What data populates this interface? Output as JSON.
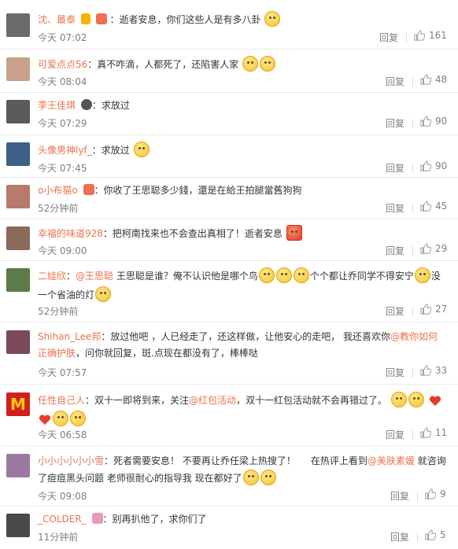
{
  "comments": [
    {
      "name": "沈、最泰",
      "badges": [
        "vip",
        "heart"
      ],
      "text": "：逝者安息，你们这些人是有多八卦",
      "emojis": 1,
      "time": "今天 07:02",
      "reply": "回复",
      "likes": "161",
      "avatar_color": "#6b6b6b"
    },
    {
      "name": "可爱点点56",
      "text": "：真不咋滴，人都死了，还陷害人家",
      "emojis": 2,
      "time": "今天 08:04",
      "reply": "回复",
      "likes": "48",
      "avatar_color": "#c9a08a"
    },
    {
      "name": "李王佳琪",
      "badges": [
        "medal"
      ],
      "text": "：求放过",
      "time": "今天 07:29",
      "reply": "回复",
      "likes": "90",
      "avatar_color": "#5a5a5a"
    },
    {
      "name": "头像男神lyf_",
      "text": "：求放过",
      "emojis": 1,
      "time": "今天 07:45",
      "reply": "回复",
      "likes": "90",
      "avatar_color": "#3e5f86"
    },
    {
      "name": "o小布猫o",
      "badges": [
        "heart"
      ],
      "text": "：你收了王思聪多少錢，還是在給王拍腿當舊狗狗",
      "time": "52分钟前",
      "reply": "回复",
      "likes": "45",
      "avatar_color": "#b87a6a"
    },
    {
      "name": "幸福的味道928",
      "text": "：把柯南找来也不会查出真相了！逝者安息",
      "emojis_red": 1,
      "time": "今天 09:00",
      "reply": "回复",
      "likes": "29",
      "avatar_color": "#8a6a5a"
    },
    {
      "name": "二娃欣",
      "mention": "@王思聪",
      "text_a": " 王思聪是谁？俺不认识他是哪个鸟",
      "text_b": "个个都让乔同学不得安宁",
      "text_c": "没一个省油的灯",
      "time": "52分钟前",
      "reply": "回复",
      "likes": "27",
      "avatar_color": "#5c7a4a"
    },
    {
      "name": "Shihan_Lee邦",
      "text_a": "：放过他吧 ，人已经走了，还这样做，让他安心的走吧， 我还喜欢你",
      "mention": "@教你如何正确护肤",
      "text_b": "，问你就回复，斑.点现在都没有了，棒棒哒",
      "time": "今天 07:57",
      "reply": "回复",
      "likes": "33",
      "avatar_color": "#7a4a5a"
    },
    {
      "name": "任性自己人",
      "text_a": "：双十一即将到来，关注",
      "mention": "@红包活动",
      "text_b": "，双十一红包活动就不会再错过了。",
      "time": "今天 06:58",
      "reply": "回复",
      "likes": "11",
      "logo": "M",
      "avatar_color": "#d02020"
    },
    {
      "name": "小小小小小小雪",
      "text_a": "：死者需要安息！ 不要再让乔任梁上热搜了！",
      "text_b": "在热评上看到",
      "mention": "@美肤素媛",
      "text_c": " 就咨询了痘痘黑头问题 老师很耐心的指导我 现在都好了",
      "time": "今天 09:08",
      "reply": "回复",
      "likes": "9",
      "avatar_color": "#9a7aa0"
    },
    {
      "name": "_COLDER_",
      "badges": [
        "crown"
      ],
      "text": "：别再扒他了，求你们了",
      "time": "11分钟前",
      "reply": "回复",
      "likes": "5",
      "avatar_color": "#4a4a4a"
    }
  ]
}
